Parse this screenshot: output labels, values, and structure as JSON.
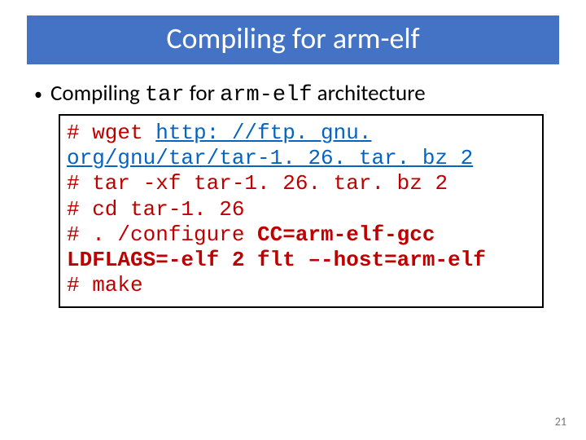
{
  "title": "Compiling for arm-elf",
  "bullet": {
    "pre": "Compiling ",
    "code1": "tar",
    "mid": " for ",
    "code2": "arm-elf",
    "post": " architecture"
  },
  "code": {
    "l1a": "# wget ",
    "l1b": "http: //ftp. gnu. org/gnu/tar/tar-1. 26. tar. bz 2",
    "l2": "# tar -xf tar-1. 26. tar. bz 2",
    "l3": "# cd tar-1. 26",
    "l4a": "# . /configure ",
    "l4b": "CC=arm-elf-gcc LDFLAGS=-elf 2 flt –-host=arm-elf",
    "l5": "# make"
  },
  "page": "21"
}
